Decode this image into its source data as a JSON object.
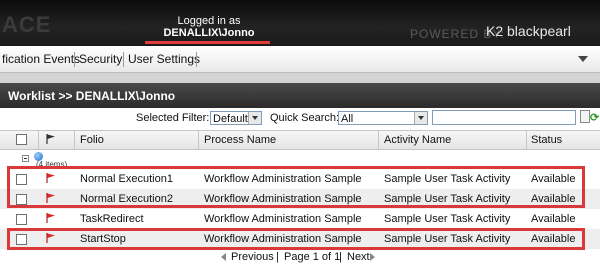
{
  "header": {
    "logo_fragment": "ACE",
    "logged_in_as": "Logged in as",
    "user": "DENALLIX\\Jonno",
    "powered_by": "POWERED BY:",
    "brand": "K2 blackpearl"
  },
  "menu": {
    "items": [
      "fication Events",
      "Security",
      "User Settings"
    ]
  },
  "panel": {
    "title": "Worklist >> DENALLIX\\Jonno"
  },
  "filters": {
    "selected_filter_label": "Selected Filter:",
    "selected_filter_value": "Default",
    "quick_search_label": "Quick Search:",
    "quick_search_value": "All",
    "search_text": ""
  },
  "table": {
    "columns": [
      "Folio",
      "Process Name",
      "Activity Name",
      "Status"
    ],
    "group_label": "(4 items)",
    "rows": [
      {
        "folio": "Normal Execution1",
        "process": "Workflow Administration Sample",
        "activity": "Sample User Task Activity",
        "status": "Available"
      },
      {
        "folio": "Normal Execution2",
        "process": "Workflow Administration Sample",
        "activity": "Sample User Task Activity",
        "status": "Available"
      },
      {
        "folio": "TaskRedirect",
        "process": "Workflow Administration Sample",
        "activity": "Sample User Task Activity",
        "status": "Available"
      },
      {
        "folio": "StartStop",
        "process": "Workflow Administration Sample",
        "activity": "Sample User Task Activity",
        "status": "Available"
      }
    ]
  },
  "pager": {
    "previous": "Previous",
    "page_info": "Page 1 of 1",
    "next": "Next"
  },
  "colors": {
    "highlight": "#d9393a",
    "flag": "#d62b2b",
    "header_bg": "#1a1a1a"
  }
}
